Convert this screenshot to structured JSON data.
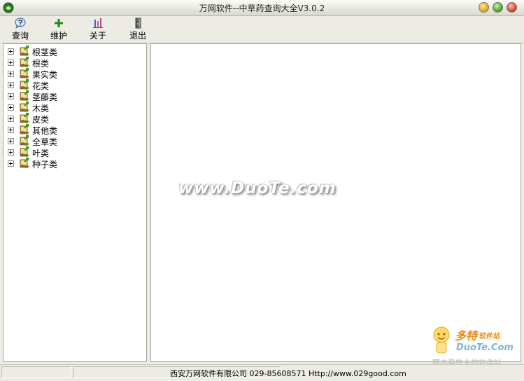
{
  "window": {
    "title": "万网软件--中草药查询大全V3.0.2"
  },
  "toolbar": {
    "items": [
      {
        "label": "查询",
        "icon": "query-icon"
      },
      {
        "label": "维护",
        "icon": "plus-icon"
      },
      {
        "label": "关于",
        "icon": "about-icon"
      },
      {
        "label": "退出",
        "icon": "exit-door-icon"
      }
    ]
  },
  "tree": {
    "items": [
      {
        "label": "根茎类"
      },
      {
        "label": "根类"
      },
      {
        "label": "果实类"
      },
      {
        "label": "花类"
      },
      {
        "label": "茎藤类"
      },
      {
        "label": "木类"
      },
      {
        "label": "皮类"
      },
      {
        "label": "其他类"
      },
      {
        "label": "全草类"
      },
      {
        "label": "叶类"
      },
      {
        "label": "种子类"
      }
    ]
  },
  "status": {
    "text": "西安万网软件有限公司 029-85608571 Http://www.029good.com"
  },
  "watermark": {
    "text": "www.DuoTe.com",
    "logo_line1": "多特",
    "logo_line1_suffix": "软件站",
    "logo_line2": "DuoTe.Com",
    "logo_line3": "国内最安全的软件站"
  },
  "colors": {
    "folder_green": "#3d9a1c",
    "book_brown": "#c8a048"
  }
}
